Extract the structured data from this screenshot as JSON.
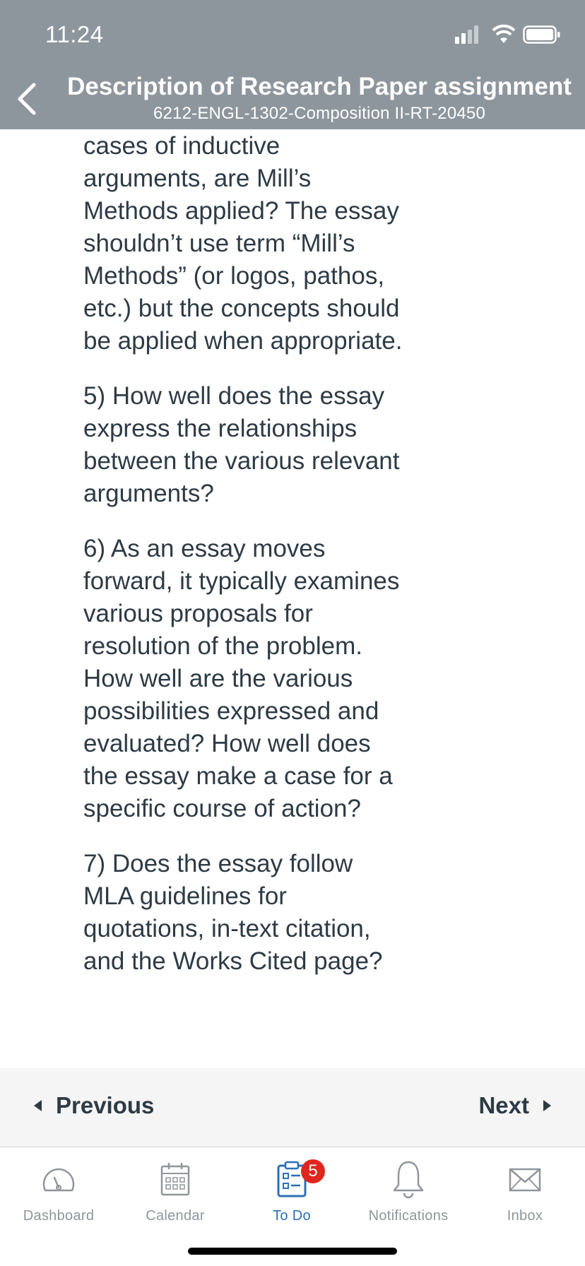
{
  "status_bar": {
    "time": "11:24"
  },
  "header": {
    "title": "Description of Research Paper assignment",
    "subtitle": "6212-ENGL-1302-Composition II-RT-20450",
    "back_icon": "chevron-left-icon"
  },
  "content": {
    "paragraphs": [
      "cases of inductive arguments, are Mill’s Methods applied? The essay shouldn’t use term “Mill’s Methods” (or logos, pathos, etc.) but the concepts should be applied when appropriate.",
      "5) How well does the essay express the relationships between the various relevant arguments?",
      "6) As an essay moves forward, it typically examines various proposals for resolution of the problem. How well are the various possibilities expressed and evaluated? How well does the essay make a case for a specific course of action?",
      "7) Does the essay follow MLA guidelines for quotations, in-text citation, and the Works Cited page?"
    ]
  },
  "pager": {
    "previous_label": "Previous",
    "next_label": "Next"
  },
  "tabs": [
    {
      "label": "Dashboard",
      "icon": "dashboard-icon",
      "active": false
    },
    {
      "label": "Calendar",
      "icon": "calendar-icon",
      "active": false
    },
    {
      "label": "To Do",
      "icon": "todo-icon",
      "active": true,
      "badge": "5"
    },
    {
      "label": "Notifications",
      "icon": "bell-icon",
      "active": false
    },
    {
      "label": "Inbox",
      "icon": "envelope-icon",
      "active": false
    }
  ],
  "colors": {
    "header_bg": "#8e969d",
    "text": "#2d3b45",
    "active_tab": "#2b6fb7",
    "inactive_tab": "#8f969c",
    "badge": "#e0261e"
  }
}
